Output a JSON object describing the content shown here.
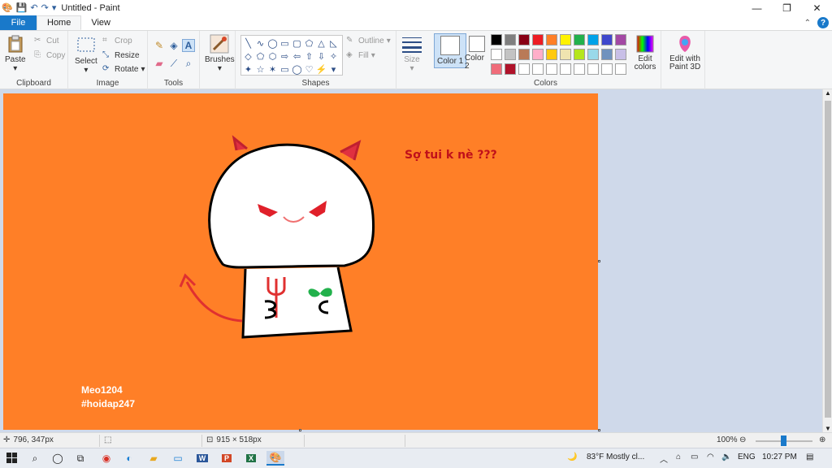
{
  "window": {
    "title": "Untitled - Paint",
    "minimize": "—",
    "maximize": "❐",
    "close": "✕"
  },
  "tabs": {
    "file": "File",
    "home": "Home",
    "view": "View"
  },
  "clipboard": {
    "paste": "Paste",
    "cut": "Cut",
    "copy": "Copy",
    "label": "Clipboard"
  },
  "image": {
    "select": "Select",
    "crop": "Crop",
    "resize": "Resize",
    "rotate": "Rotate",
    "label": "Image"
  },
  "tools": {
    "label": "Tools",
    "text_tool": "A"
  },
  "brushes": {
    "label": "Brushes"
  },
  "shapes": {
    "outline": "Outline",
    "fill": "Fill",
    "label": "Shapes",
    "glyphs": [
      "╲",
      "∿",
      "◯",
      "▭",
      "▢",
      "⬠",
      "△",
      "◺",
      "◇",
      "⬠",
      "⬡",
      "⇨",
      "⇦",
      "⇧",
      "⇩",
      "✧",
      "✦",
      "☆",
      "✶",
      "▭",
      "◯",
      "♡",
      "⚡",
      "▾"
    ]
  },
  "size": {
    "label": "Size"
  },
  "colors": {
    "color1": "Color 1",
    "color2": "Color 2",
    "edit_colors": "Edit colors",
    "edit_paint3d": "Edit with Paint 3D",
    "label": "Colors",
    "active_color1": "#ffffff",
    "active_color2": "#ffffff",
    "palette_row1": [
      "#000000",
      "#7f7f7f",
      "#880015",
      "#ed1c24",
      "#ff7f27",
      "#fff200",
      "#22b14c",
      "#00a2e8",
      "#3f48cc",
      "#a349a4"
    ],
    "palette_row2": [
      "#ffffff",
      "#c3c3c3",
      "#b97a57",
      "#ffaec9",
      "#ffc90e",
      "#efe4b0",
      "#b5e61d",
      "#99d9ea",
      "#7092be",
      "#c8bfe7"
    ],
    "palette_row3": [
      "#f06c7a",
      "#b0122a",
      "#ffffff",
      "#ffffff",
      "#ffffff",
      "#ffffff",
      "#ffffff",
      "#ffffff",
      "#ffffff",
      "#ffffff"
    ]
  },
  "canvas": {
    "background": "#ff7f27",
    "caption": "Sợ tui k nè ???",
    "signature_line1": "Meo1204",
    "signature_line2": "#hoidap247"
  },
  "status": {
    "cursor_pos": "796, 347px",
    "canvas_size": "915 × 518px",
    "zoom": "100%"
  },
  "taskbar": {
    "weather": "83°F  Mostly cl...",
    "lang": "ENG",
    "time": "10:27 PM"
  }
}
